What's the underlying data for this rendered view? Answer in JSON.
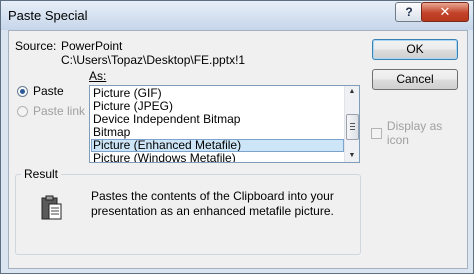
{
  "window": {
    "title": "Paste Special",
    "help_glyph": "?",
    "close_glyph": "✕"
  },
  "source": {
    "label": "Source:",
    "app": "PowerPoint",
    "path": "C:\\Users\\Topaz\\Desktop\\FE.pptx!1"
  },
  "as_label": "As:",
  "options": {
    "paste": "Paste",
    "paste_link": "Paste link"
  },
  "list": {
    "items": [
      "Picture (GIF)",
      "Picture (JPEG)",
      "Device Independent Bitmap",
      "Bitmap",
      "Picture (Enhanced Metafile)",
      "Picture (Windows Metafile)"
    ],
    "selected": "Picture (Enhanced Metafile)"
  },
  "buttons": {
    "ok": "OK",
    "cancel": "Cancel"
  },
  "display_as_icon": "Display as icon",
  "result": {
    "label": "Result",
    "text": "Pastes the contents of the Clipboard into your presentation as an enhanced metafile picture."
  },
  "icons": {
    "clipboard": "clipboard-icon",
    "help": "help-icon",
    "close": "close-icon"
  }
}
